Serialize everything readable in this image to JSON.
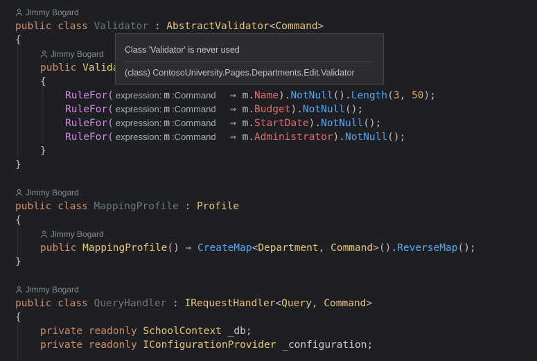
{
  "author": "Jimmy Bogard",
  "colors": {
    "background": "#1e1f22",
    "keyword": "#cf8e6d",
    "type": "#e8c37a",
    "method": "#56a8f5"
  },
  "popup": {
    "title": "Class 'Validator' is never used",
    "detail": "(class) ContosoUniversity.Pages.Departments.Edit.Validator"
  },
  "code": {
    "validator": {
      "kw_public": "public",
      "kw_class": "class",
      "name": "Validator",
      "colon": ":",
      "base": "AbstractValidator",
      "generic_open": "<",
      "generic_arg": "Command",
      "generic_close": ">",
      "brace_open": "{",
      "ctor_public": "public",
      "ctor_name_fragment": "Valida",
      "inner_brace_open": "{",
      "rules": [
        {
          "call": "RuleFor(",
          "hint": "expression:",
          "param": "m",
          "hint_type": ":Command",
          "arrow": "⇒",
          "target": "m",
          "dot": ".",
          "prop": "Name",
          "tail1": ").",
          "m1": "NotNull",
          "tail2": "().",
          "m2": "Length",
          "tail3": "(",
          "n1": "3",
          "comma": ", ",
          "n2": "50",
          "end": ");"
        },
        {
          "call": "RuleFor(",
          "hint": "expression:",
          "param": "m",
          "hint_type": ":Command",
          "arrow": "⇒",
          "target": "m",
          "dot": ".",
          "prop": "Budget",
          "tail1": ").",
          "m1": "NotNull",
          "end": "();"
        },
        {
          "call": "RuleFor(",
          "hint": "expression:",
          "param": "m",
          "hint_type": ":Command",
          "arrow": "⇒",
          "target": "m",
          "dot": ".",
          "prop": "StartDate",
          "tail1": ").",
          "m1": "NotNull",
          "end": "();"
        },
        {
          "call": "RuleFor(",
          "hint": "expression:",
          "param": "m",
          "hint_type": ":Command",
          "arrow": "⇒",
          "target": "m",
          "dot": ".",
          "prop": "Administrator",
          "tail1": ").",
          "m1": "NotNull",
          "end": "();"
        }
      ],
      "inner_brace_close": "}",
      "brace_close": "}"
    },
    "mapping": {
      "kw_public": "public",
      "kw_class": "class",
      "name": "MappingProfile",
      "colon": ":",
      "base": "Profile",
      "brace_open": "{",
      "ctor_public": "public",
      "ctor_name": "MappingProfile",
      "ctor_parens": "()",
      "arrow": "⇒",
      "create_map": "CreateMap",
      "lt": "<",
      "arg1": "Department",
      "comma": ", ",
      "arg2": "Command",
      "gt": ">",
      "mid": "().",
      "reverse": "ReverseMap",
      "end": "();",
      "brace_close": "}"
    },
    "query_handler": {
      "kw_public": "public",
      "kw_class": "class",
      "name": "QueryHandler",
      "colon": ":",
      "base": "IRequestHandler",
      "lt": "<",
      "arg1": "Query",
      "comma": ", ",
      "arg2": "Command",
      "gt": ">",
      "brace_open": "{",
      "fields": [
        {
          "kw_private": "private",
          "kw_readonly": "readonly",
          "type": "SchoolContext",
          "name": "_db",
          "end": ";"
        },
        {
          "kw_private": "private",
          "kw_readonly": "readonly",
          "type": "IConfigurationProvider",
          "name": "_configuration",
          "end": ";"
        }
      ]
    }
  }
}
